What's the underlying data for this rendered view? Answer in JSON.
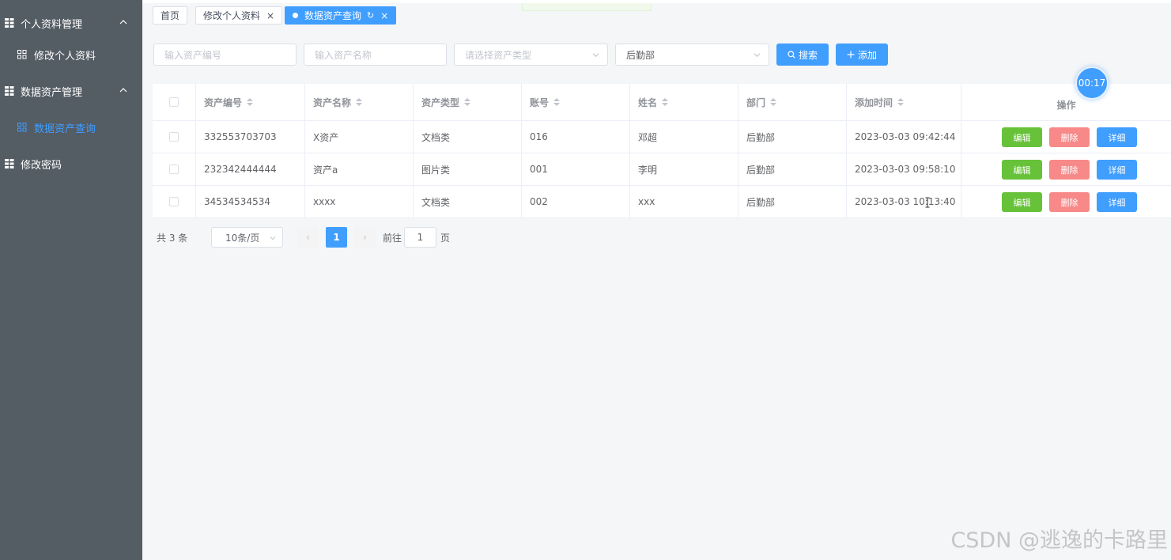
{
  "sidebar": {
    "groups": [
      {
        "label": "个人资料管理",
        "icon": "grid-icon",
        "chevron": "chevron-up-icon"
      },
      {
        "label": "数据资产管理",
        "icon": "grid-icon",
        "chevron": "chevron-up-icon"
      },
      {
        "label": "修改密码",
        "icon": "grid-icon"
      }
    ],
    "items": [
      {
        "label": "修改个人资料",
        "icon": "apps-icon",
        "active": false
      },
      {
        "label": "数据资产查询",
        "icon": "apps-icon",
        "active": true
      }
    ]
  },
  "tabs": [
    {
      "label": "首页"
    },
    {
      "label": "修改个人资料",
      "close": "×"
    },
    {
      "label": "数据资产查询",
      "close": "×",
      "refresh": "↻",
      "active": true
    }
  ],
  "filters": {
    "asset_no_placeholder": "输入资产编号",
    "asset_name_placeholder": "输入资产名称",
    "asset_type_placeholder": "请选择资产类型",
    "department_value": "后勤部",
    "search_label": "搜索",
    "add_label": "添加"
  },
  "table": {
    "headers": [
      "资产编号",
      "资产名称",
      "资产类型",
      "账号",
      "姓名",
      "部门",
      "添加时间",
      "操作"
    ],
    "rows": [
      {
        "asset_no": "332553703703",
        "name": "X资产",
        "type": "文档类",
        "account": "016",
        "person": "邓超",
        "dept": "后勤部",
        "time": "2023-03-03 09:42:44"
      },
      {
        "asset_no": "232342444444",
        "name": "资产a",
        "type": "图片类",
        "account": "001",
        "person": "李明",
        "dept": "后勤部",
        "time": "2023-03-03 09:58:10"
      },
      {
        "asset_no": "34534534534",
        "name": "xxxx",
        "type": "文档类",
        "account": "002",
        "person": "xxx",
        "dept": "后勤部",
        "time": "2023-03-03 10:13:40"
      }
    ],
    "actions": {
      "edit": "编辑",
      "delete": "删除",
      "detail": "详细"
    }
  },
  "pagination": {
    "total_text": "共 3 条",
    "page_size": "10条/页",
    "prev": "‹",
    "current": "1",
    "next": "›",
    "goto_label": "前往",
    "goto_value": "1",
    "page_suffix": "页"
  },
  "timer": "00:17",
  "watermark": "CSDN @逃逸的卡路里",
  "colors": {
    "primary": "#409eff",
    "success": "#67c23a",
    "danger": "#f78989",
    "sidebar": "#545c64"
  }
}
